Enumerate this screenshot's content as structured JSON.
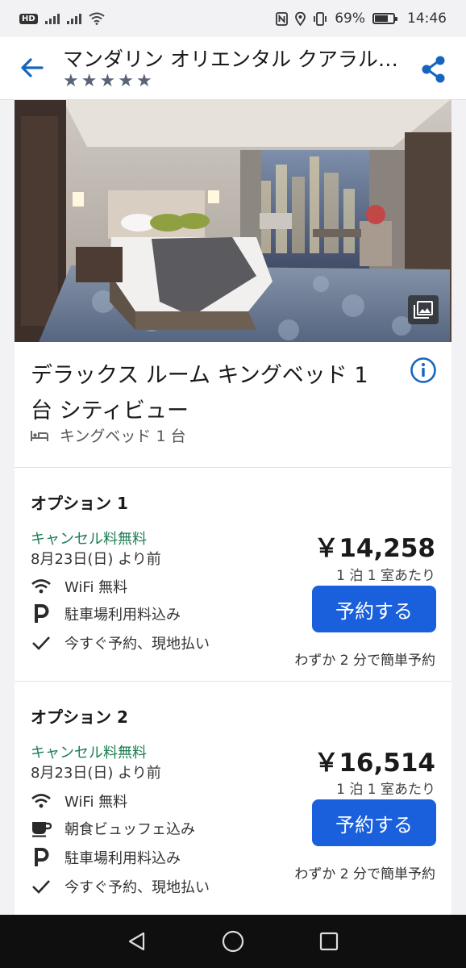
{
  "status_bar": {
    "hd": "HD",
    "battery_pct": "69%",
    "time": "14:46"
  },
  "header": {
    "title": "マンダリン オリエンタル クアラル…",
    "star_count": 5
  },
  "room": {
    "name": "デラックス ルーム キングベッド 1 台 シティビュー",
    "bed": "キングベッド 1 台"
  },
  "options": [
    {
      "title": "オプション 1",
      "cancel": "キャンセル料無料",
      "cancel_date": "8月23日(日) より前",
      "amenities": [
        {
          "icon": "wifi-icon",
          "label": "WiFi 無料"
        },
        {
          "icon": "parking-icon",
          "label": "駐車場利用料込み"
        },
        {
          "icon": "check-icon",
          "label": "今すぐ予約、現地払い"
        }
      ],
      "price": "￥14,258",
      "per_night": "1 泊 1 室あたり",
      "book_label": "予約する",
      "quick_book": "わずか 2 分で簡単予約"
    },
    {
      "title": "オプション 2",
      "cancel": "キャンセル料無料",
      "cancel_date": "8月23日(日) より前",
      "amenities": [
        {
          "icon": "wifi-icon",
          "label": "WiFi 無料"
        },
        {
          "icon": "coffee-cup-icon",
          "label": "朝食ビュッフェ込み"
        },
        {
          "icon": "parking-icon",
          "label": "駐車場利用料込み"
        },
        {
          "icon": "check-icon",
          "label": "今すぐ予約、現地払い"
        }
      ],
      "price": "￥16,514",
      "per_night": "1 泊 1 室あたり",
      "book_label": "予約する",
      "quick_book": "わずか 2 分で簡単予約"
    }
  ],
  "colors": {
    "accent": "#1a5fdb",
    "link_icon": "#1565c0",
    "free_cancel": "#1c7d54",
    "star": "#5b6477"
  }
}
